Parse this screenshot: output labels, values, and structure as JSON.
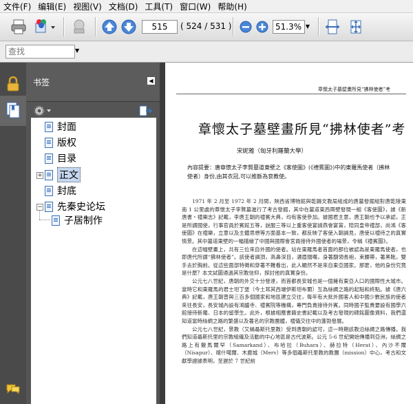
{
  "menu": [
    "文件(F)",
    "编辑(E)",
    "视图(V)",
    "文档(D)",
    "工具(T)",
    "窗口(W)",
    "帮助(H)"
  ],
  "toolbar": {
    "page_current": "515",
    "page_count": "( 524 / 531 )",
    "zoom": "51.3%"
  },
  "find": {
    "placeholder": "查找"
  },
  "bookmarks_panel": {
    "title": "书签",
    "items": [
      {
        "label": "封面",
        "level": 0
      },
      {
        "label": "版权",
        "level": 0
      },
      {
        "label": "目录",
        "level": 0
      },
      {
        "label": "正文",
        "level": 0,
        "selected": true,
        "expandable": true
      },
      {
        "label": "封底",
        "level": 0
      },
      {
        "label": "先秦史论坛",
        "level": 0,
        "expanded": true
      },
      {
        "label": "子居制作",
        "level": 1
      }
    ]
  },
  "document": {
    "running_head": "章懷太子墓壁畫所見“拂林使者”考",
    "title": "章懷太子墓壁畫所見“拂林使者”考",
    "author": "宋妮雅（匈牙利羅蘭大學）",
    "abstract": "內容提要：唐章懷太子李賢墓道東壁之《客使圖》(《禮賓圖》)中的東羅馬使者（拂林使者）身份,由其衣冠,可以推斷為袞教使。",
    "paragraphs": [
      "1971 年 2 月至 1972 年 2 月間，陝西省博物館與乾縣文教局組成的唐墓發掘組對唐乾陵東南 1 公里處的章懷太子李賢墓進行了考古發掘，其中在墓道東西兩壁發現一組《客使圖》，據《新唐書・禮樂志》記載，李唐王朝的禮賓大典，均有客使參加。據國君主意，唐王朝也予以承認，正是所謂國使，行事官員於賓館五等，說服三等以上重客使宴請燕會宴賞，陪同皇帝禮部，尚鴻《客使圖》在禮樂，立意以及主體思想等方面基本一致，都反映了客使入朝謁見，唐使以禮待之的真實情景。其中墓道東壁的一幅描繪了中國與國際會宮員接待外國使者的場景，令稱《禮賓圖》。",
      "在這幅壁畫上，共有三位來自外國的使者。站在東羅馬者首面的那位被認為是東羅馬使者，也即唐代所謂“拂林使者”。該使者謁頂，高鼻深目，濃眉闊嘴，身著翻領長袍，束腰帶，著黑靴，雙手去於胸前。從這些面部特徵和穿著不難看出，此人顯然不是來自東亞國家。那麼，他的身份究竟是什麼？本文試圖通過其宗教信仰，探討他的真實身份。",
      "公元七八世紀，唐朝的外交十分發達，而首都長安城也是一個擁有東亞人口的國際性大城市。當時它和東羅馬的君士坦丁堡（今土耳其西端伊斯坦布爾）互為絲綢之路的起點和終點。據《唐六典》記載，唐王朝曾與三百多個國家和地區建立交往，每年有大批外國客人和中國少數民族的使者來往長安，長安城內設有鴻臚寺、禮賓院等機構，專門負責接待外賓。同時國子監貴要設有國學六館接待新羅、日本的留學生。此外，根據相應書籍史書記載以及考古發現的碑銘圖像資料，我們還知道當時絲綢之路的繁盛以及著名的宗教團體，禮儀交往中的蓬勃發展。",
      "公元七八世紀，景教（又稱聶斯托里教）受到唐朝的認可，這一時期該教沿絲綢之路傳播。我們知道聶斯托里的宗教組織及活動的中心地區是古代波斯。公元 5-6 世紀開始傳播到亞洲，絲綢之路上有撒馬爾罕（Samarkand）、布哈拉（Buhara）、赫拉特（Herat）、內沙不爾（Nisapur）、喀什噶爾、木鹿城（Merv）等多個聶斯托里教的教團（mission）中心，考古和文獻學證據表明，至遲於 7 世紀前"
    ]
  }
}
